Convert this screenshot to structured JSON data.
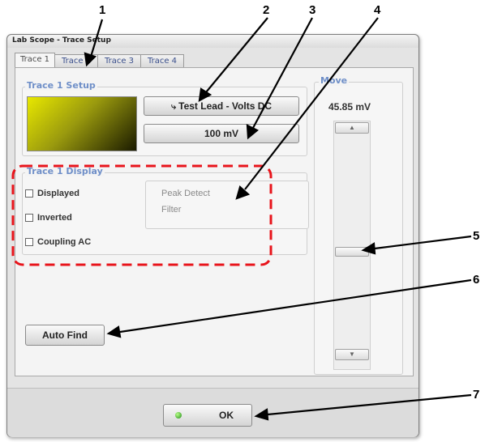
{
  "dialog": {
    "title": "Lab Scope - Trace Setup",
    "tabs": [
      "Trace 1",
      "Trace 2",
      "Trace 3",
      "Trace 4"
    ],
    "active_tab": "Trace 1"
  },
  "setup": {
    "label": "Trace 1 Setup",
    "lead_button": "Test Lead - Volts DC",
    "scale_button": "100 mV"
  },
  "display": {
    "label": "Trace 1 Display",
    "checkboxes": [
      "Displayed",
      "Inverted",
      "Coupling AC"
    ],
    "options": [
      "Peak Detect",
      "Filter"
    ]
  },
  "move": {
    "label": "Move",
    "value": "45.85 mV"
  },
  "buttons": {
    "auto_find": "Auto Find",
    "ok": "OK"
  },
  "callouts": [
    "1",
    "2",
    "3",
    "4",
    "5",
    "6",
    "7"
  ],
  "colors": {
    "group_label": "#6f8fc8",
    "highlight_box": "#e8141b",
    "trace_swatch": "#e8e800"
  }
}
